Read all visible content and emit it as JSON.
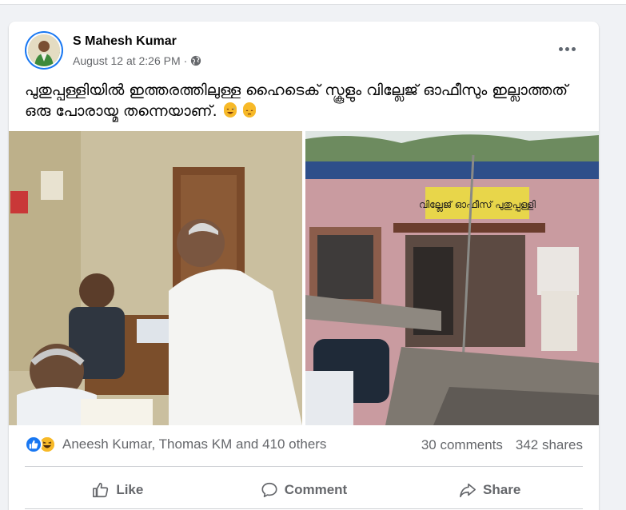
{
  "post": {
    "author": "S Mahesh Kumar",
    "timestamp": "August 12 at 2:26 PM",
    "separator": "·",
    "privacy_icon": "globe-icon",
    "text": "പുതുപ്പള്ളിയിൽ ഇത്തരത്തിലുള്ള ഹൈടെക് സ്കൂളും വില്ലേജ് ഓഫീസും ഇല്ലാത്തത് ഒരു പോരായ്മ തന്നെയാണ്.",
    "text_emojis": [
      "grinning-sweat-emoji",
      "pensive-emoji"
    ]
  },
  "photos": {
    "left_description_icon": "polling-photo",
    "right_sign_text": "വില്ലേജ് ഓഫീസ് പുതുപ്പള്ളി"
  },
  "reactions": {
    "icons": [
      "like-icon",
      "haha-icon"
    ],
    "names": "Aneesh Kumar, Thomas KM and 410 others"
  },
  "stats": {
    "comments": "30 comments",
    "shares": "342 shares"
  },
  "actions": {
    "like": "Like",
    "comment": "Comment",
    "share": "Share"
  },
  "colors": {
    "background": "#f0f2f5",
    "card": "#ffffff",
    "secondary_text": "#65676b",
    "brand_blue": "#1877f2",
    "haha_yellow": "#f7b928"
  }
}
